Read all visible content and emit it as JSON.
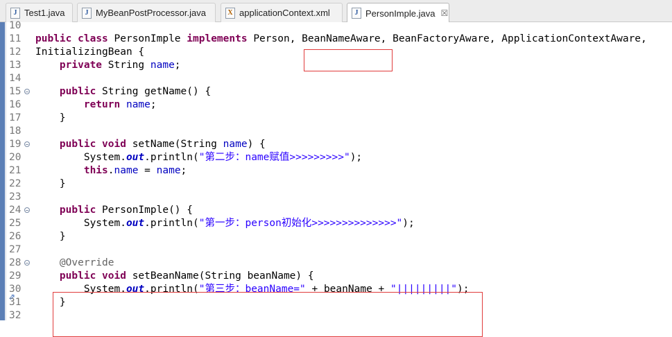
{
  "tabs": [
    {
      "label": "Test1.java",
      "icon": "java-file-icon"
    },
    {
      "label": "MyBeanPostProcessor.java",
      "icon": "java-file-icon"
    },
    {
      "label": "applicationContext.xml",
      "icon": "xml-file-icon"
    },
    {
      "label": "PersonImple.java",
      "icon": "java-file-icon",
      "active": true,
      "close": "☒"
    }
  ],
  "editor": {
    "lines": [
      {
        "n": "10",
        "t": ""
      },
      {
        "n": "11",
        "t": "public class PersonImple implements Person, BeanNameAware, BeanFactoryAware, ApplicationContextAware,"
      },
      {
        "n": "12",
        "t": "InitializingBean {"
      },
      {
        "n": "13",
        "t": "    private String name;"
      },
      {
        "n": "14",
        "t": ""
      },
      {
        "n": "15",
        "t": "    public String getName() {"
      },
      {
        "n": "16",
        "t": "        return name;"
      },
      {
        "n": "17",
        "t": "    }"
      },
      {
        "n": "18",
        "t": ""
      },
      {
        "n": "19",
        "t": "    public void setName(String name) {"
      },
      {
        "n": "20",
        "t": "        System.out.println(\"第二步：name赋值>>>>>>>>>\");"
      },
      {
        "n": "21",
        "t": "        this.name = name;"
      },
      {
        "n": "22",
        "t": "    }"
      },
      {
        "n": "23",
        "t": ""
      },
      {
        "n": "24",
        "t": "    public PersonImple() {"
      },
      {
        "n": "25",
        "t": "        System.out.println(\"第一步：person初始化>>>>>>>>>>>>>>\");"
      },
      {
        "n": "26",
        "t": "    }"
      },
      {
        "n": "27",
        "t": ""
      },
      {
        "n": "28",
        "t": "    @Override"
      },
      {
        "n": "29",
        "t": "    public void setBeanName(String beanName) {"
      },
      {
        "n": "30",
        "t": "        System.out.println(\"第三步：beanName=\" + beanName + \"|||||||||\");"
      },
      {
        "n": "31",
        "t": "    }"
      },
      {
        "n": "32",
        "t": ""
      }
    ]
  },
  "colors": {
    "keyword": "#7f0055",
    "field": "#0000c0",
    "string": "#2a00ff",
    "annotation": "#646464",
    "highlight": "#e03b3b"
  }
}
